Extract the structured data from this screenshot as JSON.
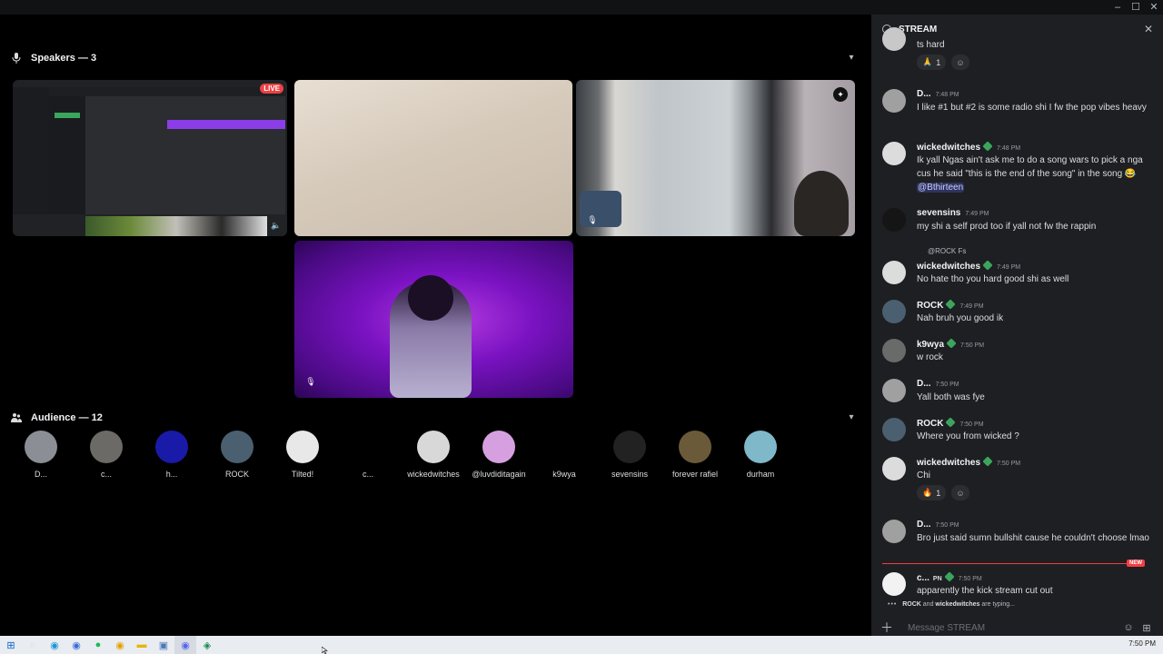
{
  "window": {
    "minimize": "–",
    "maximize": "☐",
    "close": "✕"
  },
  "speakers": {
    "title": "Speakers — 3",
    "icon": "microphone-icon"
  },
  "tiles": {
    "live_badge": "LIVE"
  },
  "audience": {
    "title": "Audience — 12",
    "icon": "users-icon",
    "members": [
      {
        "name": "D...",
        "color": "#8b8f95"
      },
      {
        "name": "c...",
        "color": "#6b6a66"
      },
      {
        "name": "h...",
        "color": "#1a1aa8"
      },
      {
        "name": "ROCK",
        "color": "#4a6070"
      },
      {
        "name": "Tilted!",
        "color": "#e8e8e8"
      },
      {
        "name": "c...",
        "color": "#000000"
      },
      {
        "name": "wickedwitches",
        "color": "#d8d8d8"
      },
      {
        "name": "@luvdiditagain",
        "color": "#d6a0e0"
      },
      {
        "name": "k9wya",
        "color": "#000000"
      },
      {
        "name": "sevensins",
        "color": "#222222"
      },
      {
        "name": "forever rafiel",
        "color": "#6b5a3a"
      },
      {
        "name": "durham",
        "color": "#7fb8c8"
      }
    ]
  },
  "chat": {
    "title": "STREAM",
    "first_line": "ts hard",
    "first_reaction": {
      "emoji": "🙏",
      "count": "1"
    },
    "messages": [
      {
        "author": "D...",
        "time": "7:48 PM",
        "badge": false,
        "text": "I like #1 but #2 is some radio shi I fw the pop vibes heavy"
      },
      {
        "author": "wickedwitches",
        "time": "7:48 PM",
        "badge": true,
        "text": "Ik yall Ngas ain't ask me to do a song wars to pick a nga cus he said \"this is the end of the song\" in the song 😂",
        "mention": "@Bthirteen"
      },
      {
        "author": "sevensins",
        "time": "7:49 PM",
        "badge": false,
        "text": "my shi a self prod too if yall not fw the rappin"
      },
      {
        "author": "wickedwitches",
        "time": "7:49 PM",
        "badge": true,
        "reply": "@ROCK Fs",
        "text": "No hate tho you hard good shi as well"
      },
      {
        "author": "ROCK",
        "time": "7:49 PM",
        "badge": true,
        "text": "Nah bruh you good ik"
      },
      {
        "author": "k9wya",
        "time": "7:50 PM",
        "badge": true,
        "text": "w rock"
      },
      {
        "author": "D...",
        "time": "7:50 PM",
        "badge": false,
        "text": "Yall both was fye"
      },
      {
        "author": "ROCK",
        "time": "7:50 PM",
        "badge": true,
        "text": "Where you from wicked ?"
      },
      {
        "author": "wickedwitches",
        "time": "7:50 PM",
        "badge": true,
        "text": "Chi"
      },
      {
        "author": "D...",
        "time": "7:50 PM",
        "badge": false,
        "text": "Bro just said sumn bullshit cause he couldn't choose lmao"
      },
      {
        "author": "c...",
        "tag": "PN",
        "time": "7:50 PM",
        "badge": true,
        "text": "apparently the kick stream cut out"
      }
    ],
    "chi_reaction": {
      "emoji": "🔥",
      "count": "1"
    },
    "new_label": "NEW",
    "typing": {
      "user1": "ROCK",
      "and": "and",
      "user2": "wickedwitches",
      "suffix": "are typing..."
    },
    "composer_placeholder": "Message STREAM"
  },
  "taskbar": {
    "clock": "7:50 PM"
  },
  "colors": {
    "accent_green": "#3ba55d",
    "live_red": "#ed4245",
    "mention_bg": "#3c4270"
  }
}
